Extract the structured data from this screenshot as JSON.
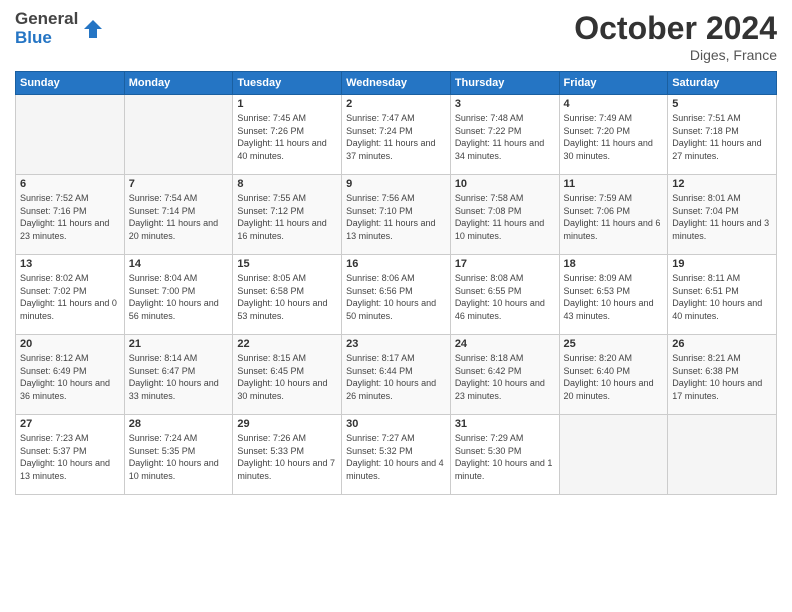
{
  "logo": {
    "general": "General",
    "blue": "Blue"
  },
  "header": {
    "month": "October 2024",
    "location": "Diges, France"
  },
  "weekdays": [
    "Sunday",
    "Monday",
    "Tuesday",
    "Wednesday",
    "Thursday",
    "Friday",
    "Saturday"
  ],
  "weeks": [
    [
      {
        "day": "",
        "sunrise": "",
        "sunset": "",
        "daylight": ""
      },
      {
        "day": "",
        "sunrise": "",
        "sunset": "",
        "daylight": ""
      },
      {
        "day": "1",
        "sunrise": "Sunrise: 7:45 AM",
        "sunset": "Sunset: 7:26 PM",
        "daylight": "Daylight: 11 hours and 40 minutes."
      },
      {
        "day": "2",
        "sunrise": "Sunrise: 7:47 AM",
        "sunset": "Sunset: 7:24 PM",
        "daylight": "Daylight: 11 hours and 37 minutes."
      },
      {
        "day": "3",
        "sunrise": "Sunrise: 7:48 AM",
        "sunset": "Sunset: 7:22 PM",
        "daylight": "Daylight: 11 hours and 34 minutes."
      },
      {
        "day": "4",
        "sunrise": "Sunrise: 7:49 AM",
        "sunset": "Sunset: 7:20 PM",
        "daylight": "Daylight: 11 hours and 30 minutes."
      },
      {
        "day": "5",
        "sunrise": "Sunrise: 7:51 AM",
        "sunset": "Sunset: 7:18 PM",
        "daylight": "Daylight: 11 hours and 27 minutes."
      }
    ],
    [
      {
        "day": "6",
        "sunrise": "Sunrise: 7:52 AM",
        "sunset": "Sunset: 7:16 PM",
        "daylight": "Daylight: 11 hours and 23 minutes."
      },
      {
        "day": "7",
        "sunrise": "Sunrise: 7:54 AM",
        "sunset": "Sunset: 7:14 PM",
        "daylight": "Daylight: 11 hours and 20 minutes."
      },
      {
        "day": "8",
        "sunrise": "Sunrise: 7:55 AM",
        "sunset": "Sunset: 7:12 PM",
        "daylight": "Daylight: 11 hours and 16 minutes."
      },
      {
        "day": "9",
        "sunrise": "Sunrise: 7:56 AM",
        "sunset": "Sunset: 7:10 PM",
        "daylight": "Daylight: 11 hours and 13 minutes."
      },
      {
        "day": "10",
        "sunrise": "Sunrise: 7:58 AM",
        "sunset": "Sunset: 7:08 PM",
        "daylight": "Daylight: 11 hours and 10 minutes."
      },
      {
        "day": "11",
        "sunrise": "Sunrise: 7:59 AM",
        "sunset": "Sunset: 7:06 PM",
        "daylight": "Daylight: 11 hours and 6 minutes."
      },
      {
        "day": "12",
        "sunrise": "Sunrise: 8:01 AM",
        "sunset": "Sunset: 7:04 PM",
        "daylight": "Daylight: 11 hours and 3 minutes."
      }
    ],
    [
      {
        "day": "13",
        "sunrise": "Sunrise: 8:02 AM",
        "sunset": "Sunset: 7:02 PM",
        "daylight": "Daylight: 11 hours and 0 minutes."
      },
      {
        "day": "14",
        "sunrise": "Sunrise: 8:04 AM",
        "sunset": "Sunset: 7:00 PM",
        "daylight": "Daylight: 10 hours and 56 minutes."
      },
      {
        "day": "15",
        "sunrise": "Sunrise: 8:05 AM",
        "sunset": "Sunset: 6:58 PM",
        "daylight": "Daylight: 10 hours and 53 minutes."
      },
      {
        "day": "16",
        "sunrise": "Sunrise: 8:06 AM",
        "sunset": "Sunset: 6:56 PM",
        "daylight": "Daylight: 10 hours and 50 minutes."
      },
      {
        "day": "17",
        "sunrise": "Sunrise: 8:08 AM",
        "sunset": "Sunset: 6:55 PM",
        "daylight": "Daylight: 10 hours and 46 minutes."
      },
      {
        "day": "18",
        "sunrise": "Sunrise: 8:09 AM",
        "sunset": "Sunset: 6:53 PM",
        "daylight": "Daylight: 10 hours and 43 minutes."
      },
      {
        "day": "19",
        "sunrise": "Sunrise: 8:11 AM",
        "sunset": "Sunset: 6:51 PM",
        "daylight": "Daylight: 10 hours and 40 minutes."
      }
    ],
    [
      {
        "day": "20",
        "sunrise": "Sunrise: 8:12 AM",
        "sunset": "Sunset: 6:49 PM",
        "daylight": "Daylight: 10 hours and 36 minutes."
      },
      {
        "day": "21",
        "sunrise": "Sunrise: 8:14 AM",
        "sunset": "Sunset: 6:47 PM",
        "daylight": "Daylight: 10 hours and 33 minutes."
      },
      {
        "day": "22",
        "sunrise": "Sunrise: 8:15 AM",
        "sunset": "Sunset: 6:45 PM",
        "daylight": "Daylight: 10 hours and 30 minutes."
      },
      {
        "day": "23",
        "sunrise": "Sunrise: 8:17 AM",
        "sunset": "Sunset: 6:44 PM",
        "daylight": "Daylight: 10 hours and 26 minutes."
      },
      {
        "day": "24",
        "sunrise": "Sunrise: 8:18 AM",
        "sunset": "Sunset: 6:42 PM",
        "daylight": "Daylight: 10 hours and 23 minutes."
      },
      {
        "day": "25",
        "sunrise": "Sunrise: 8:20 AM",
        "sunset": "Sunset: 6:40 PM",
        "daylight": "Daylight: 10 hours and 20 minutes."
      },
      {
        "day": "26",
        "sunrise": "Sunrise: 8:21 AM",
        "sunset": "Sunset: 6:38 PM",
        "daylight": "Daylight: 10 hours and 17 minutes."
      }
    ],
    [
      {
        "day": "27",
        "sunrise": "Sunrise: 7:23 AM",
        "sunset": "Sunset: 5:37 PM",
        "daylight": "Daylight: 10 hours and 13 minutes."
      },
      {
        "day": "28",
        "sunrise": "Sunrise: 7:24 AM",
        "sunset": "Sunset: 5:35 PM",
        "daylight": "Daylight: 10 hours and 10 minutes."
      },
      {
        "day": "29",
        "sunrise": "Sunrise: 7:26 AM",
        "sunset": "Sunset: 5:33 PM",
        "daylight": "Daylight: 10 hours and 7 minutes."
      },
      {
        "day": "30",
        "sunrise": "Sunrise: 7:27 AM",
        "sunset": "Sunset: 5:32 PM",
        "daylight": "Daylight: 10 hours and 4 minutes."
      },
      {
        "day": "31",
        "sunrise": "Sunrise: 7:29 AM",
        "sunset": "Sunset: 5:30 PM",
        "daylight": "Daylight: 10 hours and 1 minute."
      },
      {
        "day": "",
        "sunrise": "",
        "sunset": "",
        "daylight": ""
      },
      {
        "day": "",
        "sunrise": "",
        "sunset": "",
        "daylight": ""
      }
    ]
  ]
}
